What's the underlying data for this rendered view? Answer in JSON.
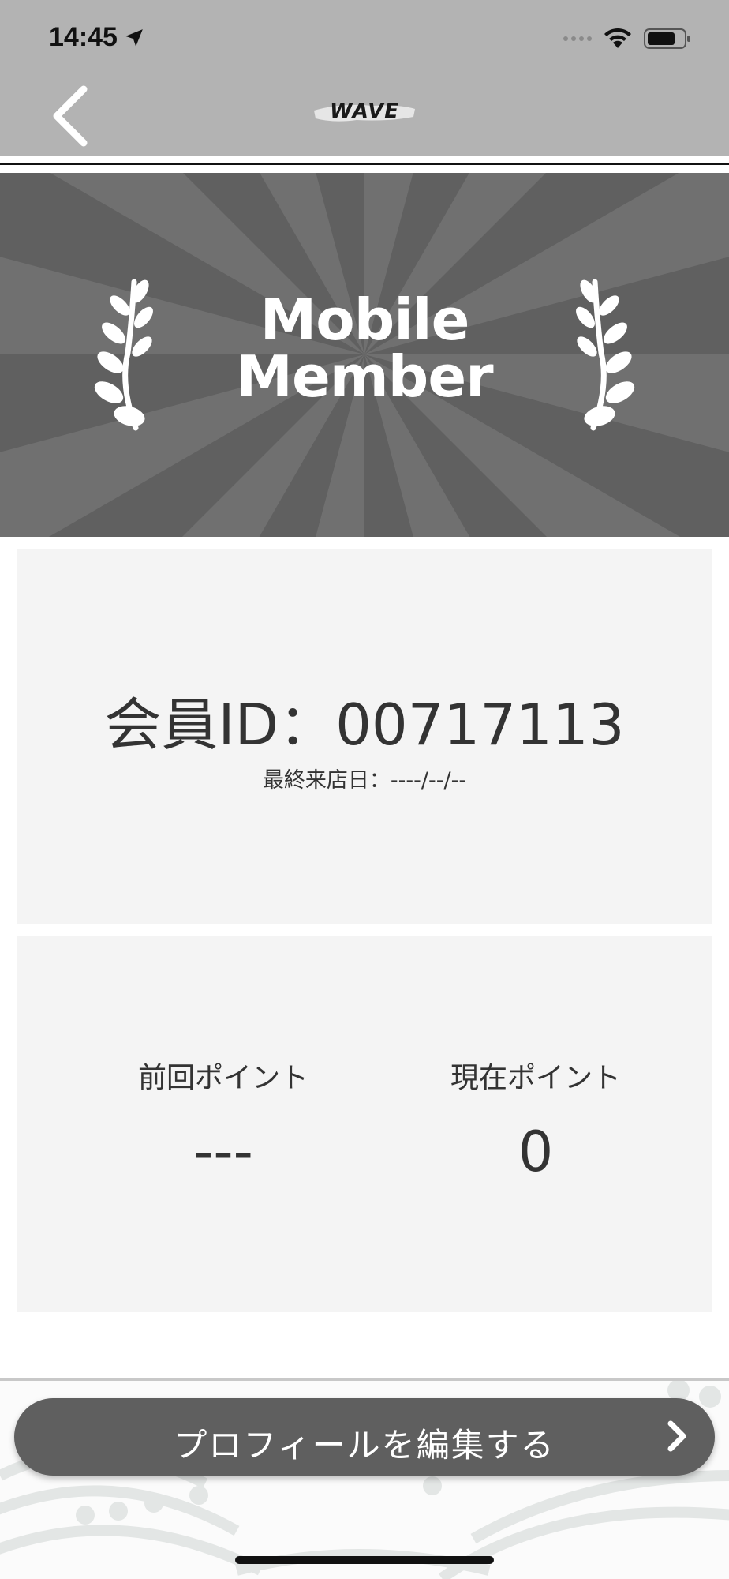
{
  "status_bar": {
    "time": "14:45",
    "location_icon": "location-arrow-icon",
    "signal_icon": "cellular-signal-icon",
    "wifi_icon": "wifi-icon",
    "battery_icon": "battery-icon"
  },
  "nav": {
    "back_icon": "chevron-left-icon",
    "logo_text": "WAVE"
  },
  "banner": {
    "title_line1": "Mobile",
    "title_line2": "Member",
    "left_icon": "laurel-branch-icon",
    "right_icon": "laurel-branch-icon"
  },
  "member": {
    "id_text": "会員ID：00717113",
    "last_visit": "最終来店日：----/--/--"
  },
  "points": {
    "previous_label": "前回ポイント",
    "previous_value": "---",
    "current_label": "現在ポイント",
    "current_value": "0"
  },
  "actions": {
    "edit_profile_label": "プロフィールを編集する",
    "edit_profile_icon": "chevron-right-icon"
  },
  "colors": {
    "header_bg": "#b3b3b3",
    "banner_bg": "#606060",
    "card_bg": "#f4f4f4",
    "button_bg": "#5f5f5f",
    "text": "#333333"
  }
}
